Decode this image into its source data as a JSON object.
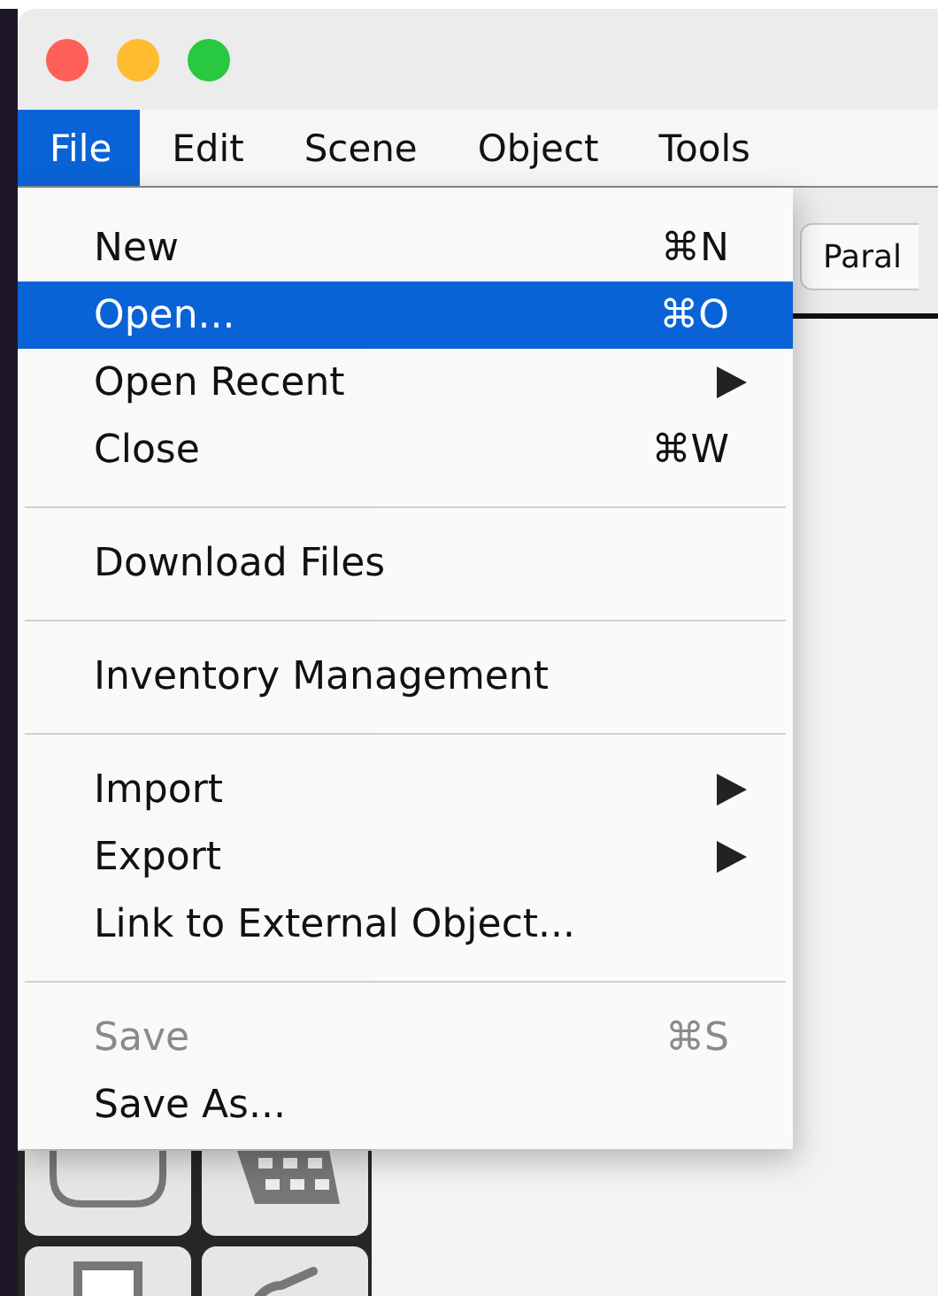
{
  "window": {
    "controls": [
      {
        "kind": "close"
      },
      {
        "kind": "minimize"
      },
      {
        "kind": "zoom"
      }
    ]
  },
  "menubar": [
    {
      "label": "File",
      "selected": true
    },
    {
      "label": "Edit",
      "selected": false
    },
    {
      "label": "Scene",
      "selected": false
    },
    {
      "label": "Object",
      "selected": false
    },
    {
      "label": "Tools",
      "selected": false
    }
  ],
  "file_menu": [
    {
      "kind": "item",
      "label": "New",
      "shortcut": "⌘N",
      "submenu": false,
      "disabled": false,
      "selected": false
    },
    {
      "kind": "item",
      "label": "Open...",
      "shortcut": "⌘O",
      "submenu": false,
      "disabled": false,
      "selected": true
    },
    {
      "kind": "item",
      "label": "Open Recent",
      "submenu": true,
      "disabled": false,
      "selected": false
    },
    {
      "kind": "item",
      "label": "Close",
      "shortcut": "⌘W",
      "submenu": false,
      "disabled": false,
      "selected": false
    },
    {
      "kind": "separator"
    },
    {
      "kind": "item",
      "label": "Download Files",
      "submenu": false,
      "disabled": false,
      "selected": false
    },
    {
      "kind": "separator"
    },
    {
      "kind": "item",
      "label": "Inventory Management",
      "submenu": false,
      "disabled": false,
      "selected": false
    },
    {
      "kind": "separator"
    },
    {
      "kind": "item",
      "label": "Import",
      "submenu": true,
      "disabled": false,
      "selected": false
    },
    {
      "kind": "item",
      "label": "Export",
      "submenu": true,
      "disabled": false,
      "selected": false
    },
    {
      "kind": "item",
      "label": "Link to External Object...",
      "submenu": false,
      "disabled": false,
      "selected": false
    },
    {
      "kind": "separator"
    },
    {
      "kind": "item",
      "label": "Save",
      "shortcut": "⌘S",
      "submenu": false,
      "disabled": true,
      "selected": false
    },
    {
      "kind": "item",
      "label": "Save As...",
      "submenu": false,
      "disabled": false,
      "selected": false
    }
  ],
  "toolbar": {
    "buttons": [
      {
        "label": "Paral"
      }
    ]
  }
}
